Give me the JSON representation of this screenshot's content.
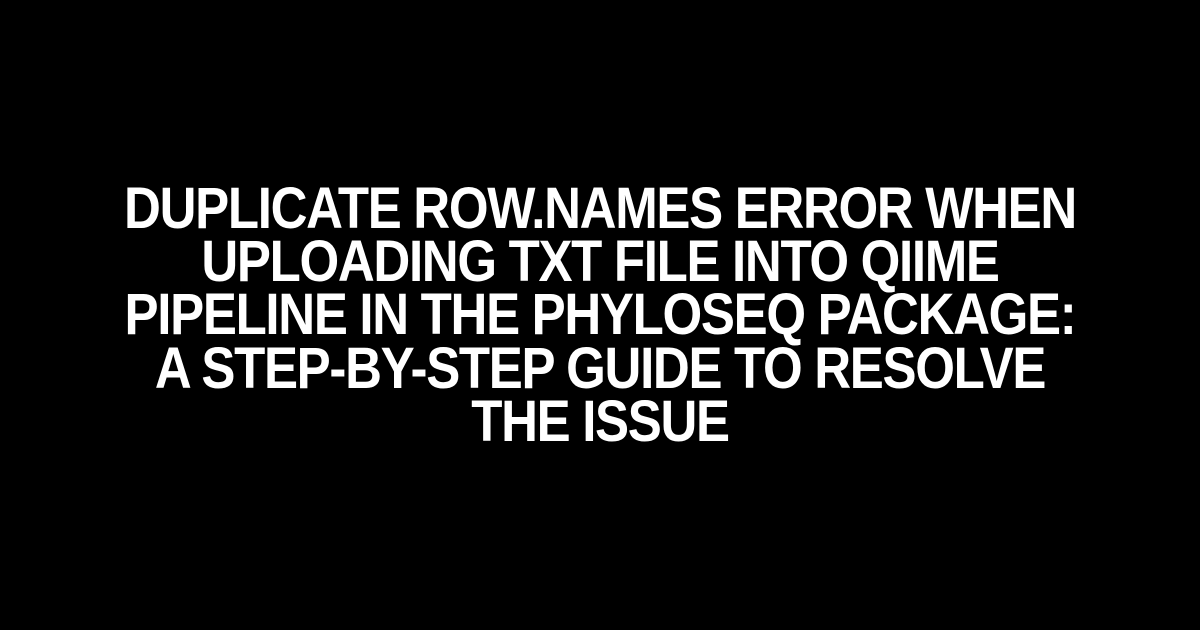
{
  "title": "DUPLICATE ROW.NAMES ERROR WHEN UPLOADING TXT FILE INTO QIIME PIPELINE IN THE PHYLOSEQ PACKAGE: A STEP-BY-STEP GUIDE TO RESOLVE THE ISSUE"
}
